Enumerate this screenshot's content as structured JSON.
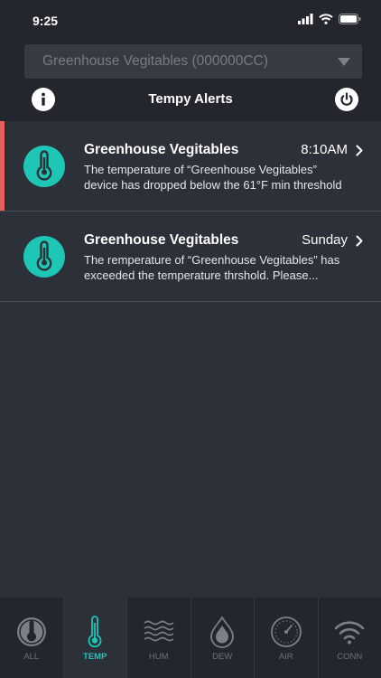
{
  "status_bar": {
    "time": "9:25"
  },
  "header": {
    "device_select": {
      "value": "Greenhouse Vegitables (000000CC)"
    },
    "title": "Tempy Alerts"
  },
  "alerts": [
    {
      "title": "Greenhouse Vegitables",
      "time": "8:10AM",
      "line1": "The temperature of “Greenhouse Vegitables”",
      "line2": "device has dropped below the 61°F min threshold",
      "unread": true
    },
    {
      "title": "Greenhouse Vegitables",
      "time": "Sunday",
      "line1": "The remperature of  “Greenhouse Vegitables” has",
      "line2": "exceeded the temperature thrshold. Please...",
      "unread": false
    }
  ],
  "tabs": [
    {
      "label": "ALL",
      "icon": "all-icon",
      "active": false
    },
    {
      "label": "TEMP",
      "icon": "thermometer-icon",
      "active": true
    },
    {
      "label": "HUM",
      "icon": "humidity-waves-icon",
      "active": false
    },
    {
      "label": "DEW",
      "icon": "dew-drop-icon",
      "active": false
    },
    {
      "label": "AIR",
      "icon": "air-gauge-icon",
      "active": false
    },
    {
      "label": "CONN",
      "icon": "wifi-icon",
      "active": false
    }
  ],
  "colors": {
    "accent": "#1ec6b6",
    "unread_marker": "#e8615c",
    "background": "#2c3039",
    "header": "#23262d"
  }
}
